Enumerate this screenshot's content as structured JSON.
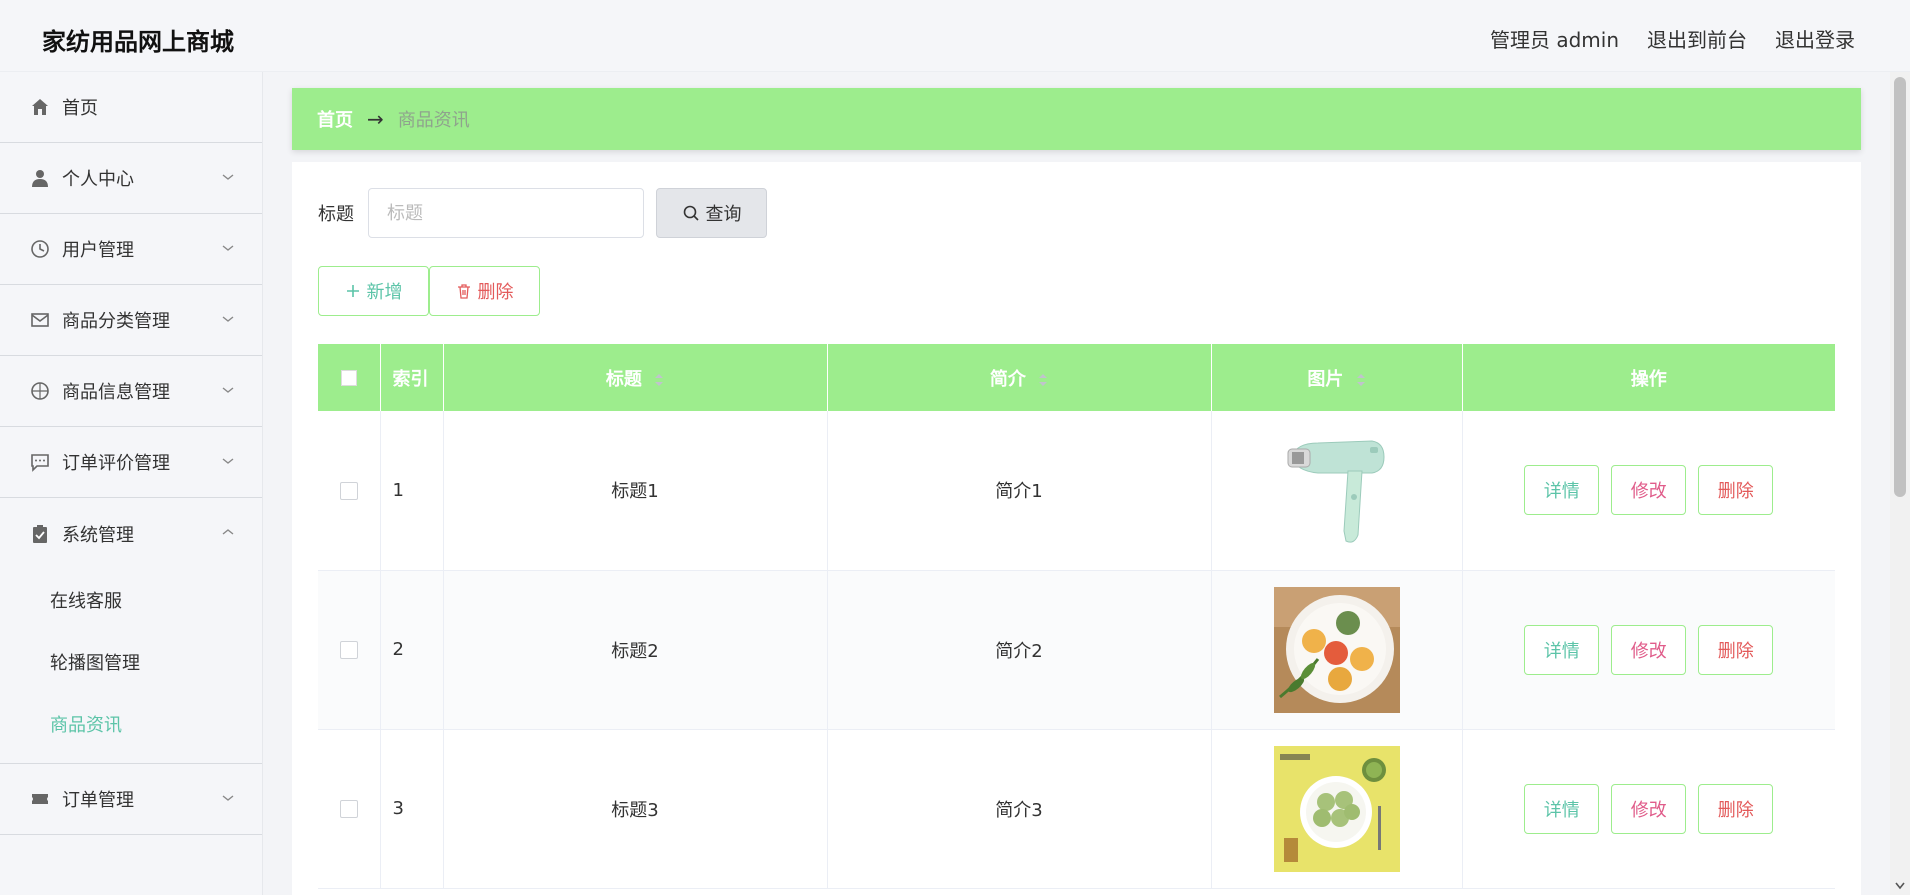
{
  "header": {
    "brand": "家纺用品网上商城",
    "admin_label": "管理员 admin",
    "exit_front": "退出到前台",
    "logout": "退出登录"
  },
  "sidebar": {
    "items": [
      {
        "label": "首页",
        "icon": "home-icon"
      },
      {
        "label": "个人中心",
        "icon": "user-icon"
      },
      {
        "label": "用户管理",
        "icon": "clock-icon"
      },
      {
        "label": "商品分类管理",
        "icon": "mail-icon"
      },
      {
        "label": "商品信息管理",
        "icon": "compass-icon"
      },
      {
        "label": "订单评价管理",
        "icon": "chat-icon"
      },
      {
        "label": "系统管理",
        "icon": "clipboard-icon"
      },
      {
        "label": "订单管理",
        "icon": "ticket-icon"
      }
    ],
    "sub_items": [
      {
        "label": "在线客服"
      },
      {
        "label": "轮播图管理"
      },
      {
        "label": "商品资讯"
      }
    ]
  },
  "breadcrumb": {
    "home": "首页",
    "arrow": "→",
    "current": "商品资讯"
  },
  "search": {
    "label": "标题",
    "placeholder": "标题",
    "button": "查询"
  },
  "actions": {
    "add": "新增",
    "delete": "删除"
  },
  "table": {
    "headers": [
      "索引",
      "标题",
      "简介",
      "图片",
      "操作"
    ],
    "rows": [
      {
        "index": "1",
        "title": "标题1",
        "intro": "简介1",
        "image": "hair-dryer"
      },
      {
        "index": "2",
        "title": "标题2",
        "intro": "简介2",
        "image": "mooncakes"
      },
      {
        "index": "3",
        "title": "标题3",
        "intro": "简介3",
        "image": "matcha-cakes"
      }
    ],
    "ops": {
      "detail": "详情",
      "edit": "修改",
      "delete": "删除"
    }
  },
  "colors": {
    "accent_green": "#9ded8d",
    "teal": "#5cc4a8",
    "pink": "#e05c8a",
    "red": "#e35a5a"
  }
}
